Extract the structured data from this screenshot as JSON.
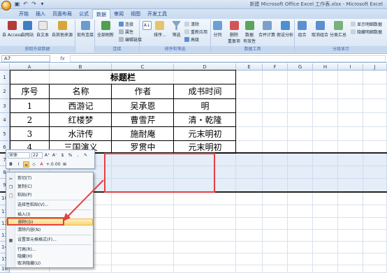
{
  "window": {
    "title": "新建 Microsoft Office Excel 工作表.xlsx - Microsoft Excel",
    "qat": [
      "save-icon",
      "undo-icon",
      "redo-icon",
      "dropdown-icon"
    ]
  },
  "ribbon": {
    "tabs": [
      "开始",
      "插入",
      "页面布局",
      "公式",
      "数据",
      "审阅",
      "视图",
      "开发工具"
    ],
    "active_tab": "数据",
    "groups": {
      "get_external": {
        "label": "获取外部数据",
        "buttons": [
          "自 Access",
          "自网站",
          "自文本",
          "自其他来源",
          "现有连接"
        ]
      },
      "connections": {
        "label": "连接",
        "refresh": "全部刷新",
        "small": [
          "连接",
          "属性",
          "编辑链接"
        ]
      },
      "sort_filter": {
        "label": "排序和筛选",
        "sort": "排序...",
        "filter": "筛选",
        "small": [
          "清除",
          "重新应用",
          "高级"
        ]
      },
      "data_tools": {
        "label": "数据工具",
        "buttons": [
          "分列",
          "删除\n重复项",
          "数据\n有效性",
          "合并计算",
          "假设分析"
        ]
      },
      "outline": {
        "label": "分级显示",
        "buttons": [
          "组合",
          "取消组合",
          "分类汇总"
        ],
        "small": [
          "显示明细数据",
          "隐藏明细数据"
        ]
      }
    }
  },
  "formula_bar": {
    "name_box": "A7",
    "fx": "fx",
    "value": ""
  },
  "grid": {
    "columns": [
      "A",
      "B",
      "C",
      "D",
      "E",
      "F",
      "G",
      "H",
      "I",
      "J"
    ],
    "rows": [
      "1",
      "2",
      "3",
      "4",
      "5",
      "6",
      "7",
      "8",
      "9",
      "10",
      "11",
      "12",
      "13",
      "14",
      "15",
      "16",
      "17"
    ]
  },
  "table": {
    "title": "标题栏",
    "headers": [
      "序号",
      "名称",
      "作者",
      "成书时间"
    ],
    "rows": [
      [
        "1",
        "西游记",
        "吴承恩",
        "明"
      ],
      [
        "2",
        "红楼梦",
        "曹雪芹",
        "清・乾隆"
      ],
      [
        "3",
        "水浒传",
        "施耐庵",
        "元末明初"
      ],
      [
        "4",
        "三国演义",
        "罗贯中",
        "元末明初"
      ]
    ]
  },
  "mini_toolbar": {
    "font": "宋体",
    "size": "22",
    "row1_icons": [
      "grow-font-icon",
      "shrink-font-icon",
      "currency-icon",
      "percent-icon",
      "comma-icon",
      "format-painter-icon"
    ],
    "row2_labels": [
      "B",
      "I",
      "≡",
      "◇",
      "A",
      "+.0",
      ".00",
      "⊞"
    ]
  },
  "context_menu": {
    "items": [
      {
        "label": "剪切(T)",
        "icon": "cut-icon"
      },
      {
        "label": "复制(C)",
        "icon": "copy-icon"
      },
      {
        "label": "粘贴(P)",
        "icon": "paste-icon"
      },
      {
        "label": "选择性粘贴(V)...",
        "icon": ""
      },
      {
        "label": "插入(I)",
        "icon": ""
      },
      {
        "label": "删除(D)",
        "icon": ""
      },
      {
        "label": "清除内容(N)",
        "icon": ""
      },
      {
        "label": "设置单元格格式(F)...",
        "icon": "format-cells-icon"
      },
      {
        "label": "行高(R)...",
        "icon": ""
      },
      {
        "label": "隐藏(H)",
        "icon": ""
      },
      {
        "label": "取消隐藏(U)",
        "icon": ""
      }
    ],
    "highlighted": "删除(D)"
  },
  "colors": {
    "annotation_red": "#e4413e",
    "menu_highlight": "#fbd574",
    "ribbon_blue": "#15428b"
  }
}
